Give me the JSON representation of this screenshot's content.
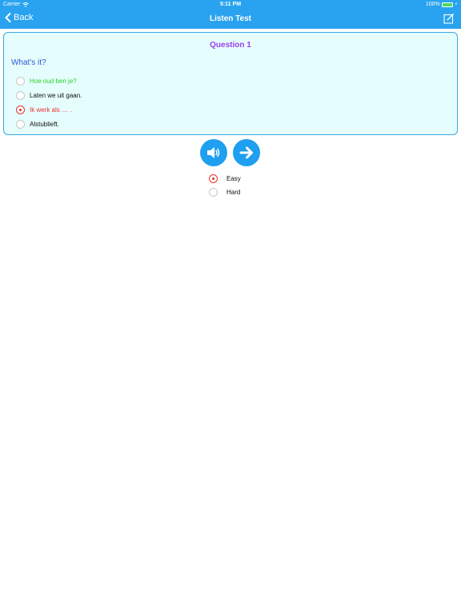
{
  "status_bar": {
    "carrier": "Carrier",
    "time": "5:11 PM",
    "battery": "100%"
  },
  "nav": {
    "back_label": "Back",
    "title": "Listen Test"
  },
  "question": {
    "title": "Question 1",
    "prompt": "What's it?",
    "options": [
      {
        "text": "Hoe oud ben je?",
        "state": "correct"
      },
      {
        "text": "Laten we uit gaan.",
        "state": "normal"
      },
      {
        "text": "Ik werk als … .",
        "state": "selected-wrong"
      },
      {
        "text": "Alstublieft.",
        "state": "normal"
      }
    ]
  },
  "difficulty": {
    "options": [
      {
        "text": "Easy",
        "selected": true
      },
      {
        "text": "Hard",
        "selected": false
      }
    ]
  },
  "colors": {
    "nav_bar": "#29a3ef",
    "card_bg": "#e6fdfd",
    "card_border": "#38a8e4",
    "question_title": "#9a3ff0",
    "prompt": "#2b58d6",
    "correct": "#27d427",
    "wrong": "#e8322e",
    "button": "#1e9ff0"
  },
  "icons": {
    "back": "chevron-left-icon",
    "compose": "compose-icon",
    "speaker": "speaker-icon",
    "next": "arrow-right-icon"
  }
}
